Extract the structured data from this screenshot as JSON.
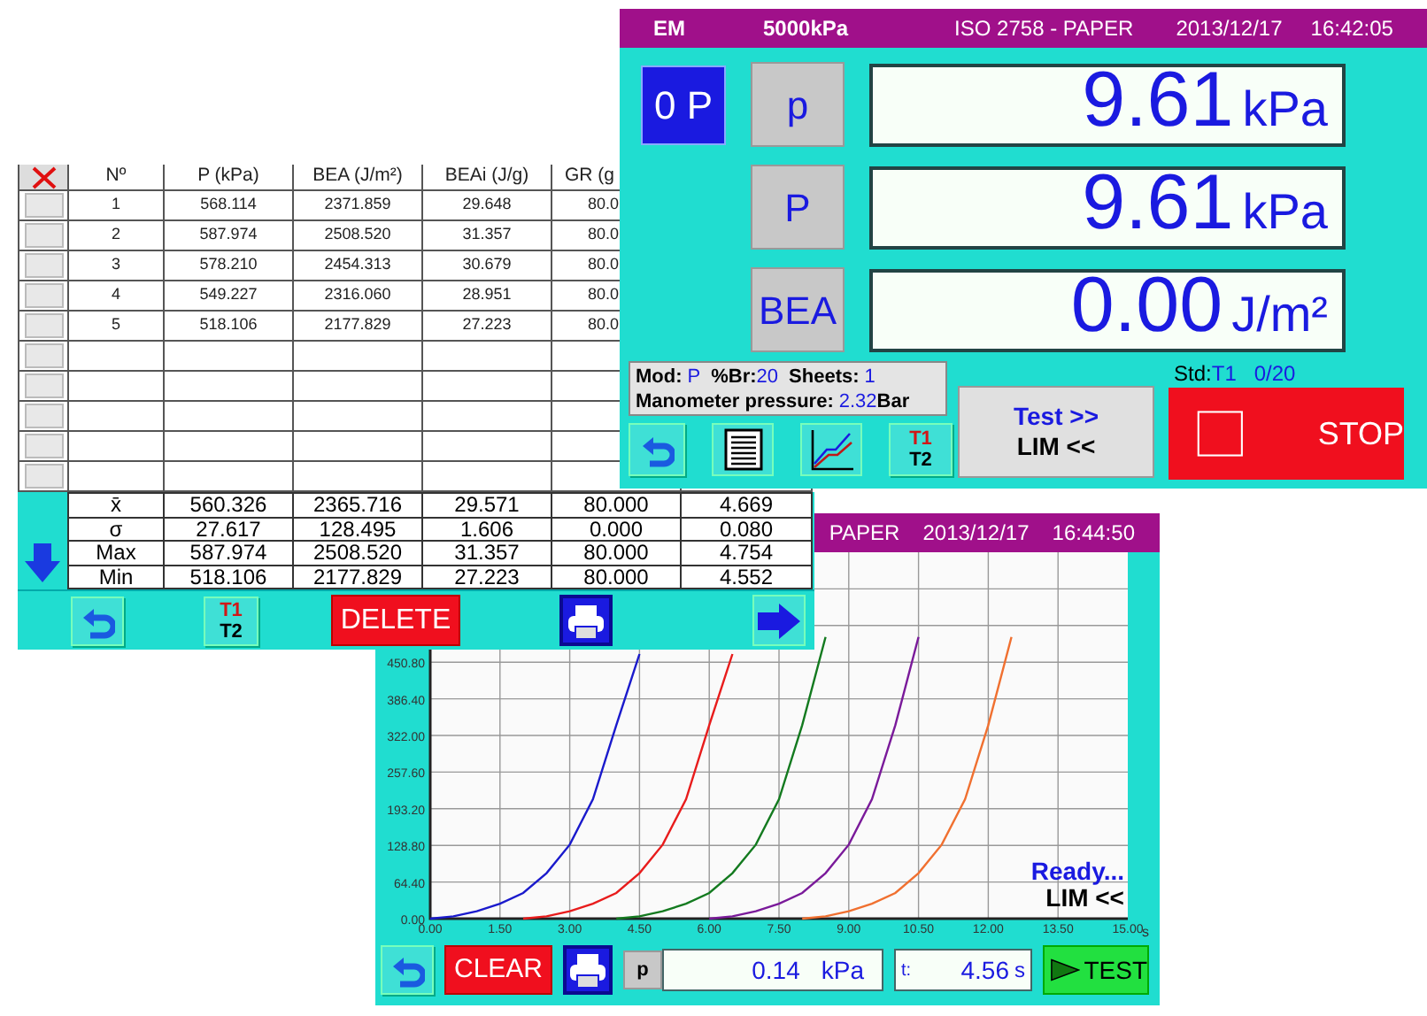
{
  "results_window": {
    "columns": [
      "Nº",
      "P (kPa)",
      "BEA (J/m²)",
      "BEAi (J/g)",
      "GR (g"
    ],
    "rows": [
      {
        "checked": false,
        "cells": [
          "1",
          "568.114",
          "2371.859",
          "29.648",
          "80.0"
        ]
      },
      {
        "checked": false,
        "cells": [
          "2",
          "587.974",
          "2508.520",
          "31.357",
          "80.0"
        ]
      },
      {
        "checked": false,
        "cells": [
          "3",
          "578.210",
          "2454.313",
          "30.679",
          "80.0"
        ]
      },
      {
        "checked": false,
        "cells": [
          "4",
          "549.227",
          "2316.060",
          "28.951",
          "80.0"
        ]
      },
      {
        "checked": false,
        "cells": [
          "5",
          "518.106",
          "2177.829",
          "27.223",
          "80.0"
        ]
      },
      {
        "checked": false
      },
      {
        "checked": false
      },
      {
        "checked": false
      },
      {
        "checked": false
      },
      {
        "checked": false
      }
    ],
    "stats": [
      {
        "label": "x̄",
        "cells": [
          "560.326",
          "2365.716",
          "29.571",
          "80.000",
          "4.669"
        ]
      },
      {
        "label": "σ",
        "cells": [
          "27.617",
          "128.495",
          "1.606",
          "0.000",
          "0.080"
        ]
      },
      {
        "label": "Max",
        "cells": [
          "587.974",
          "2508.520",
          "31.357",
          "80.000",
          "4.754"
        ]
      },
      {
        "label": "Min",
        "cells": [
          "518.106",
          "2177.829",
          "27.223",
          "80.000",
          "4.552"
        ]
      }
    ],
    "toolbar": {
      "t1": "T1",
      "t2": "T2",
      "delete": "DELETE"
    }
  },
  "test_window": {
    "title_bar": [
      "EM",
      "5000kPa",
      "ISO 2758 - PAPER",
      "2013/12/17",
      "16:42:05"
    ],
    "zero_button": "0 P",
    "displays": [
      {
        "key": "p",
        "value": "9.61",
        "unit": "kPa"
      },
      {
        "key": "P",
        "value": "9.61",
        "unit": "kPa"
      },
      {
        "key": "BEA",
        "value": "0.00",
        "unit": "J/m²"
      }
    ],
    "info": {
      "mod_label": "Mod:",
      "mod": "P",
      "br_label": "%Br:",
      "br": "20",
      "sheets_label": "Sheets:",
      "sheets": "1",
      "manometer_label": "Manometer pressure:",
      "manometer": "2.32",
      "manometer_unit": "Bar"
    },
    "std_label": "Std:",
    "std": "T1",
    "count": "0/20",
    "toolbar": {
      "t1": "T1",
      "t2": "T2"
    },
    "test_button": [
      "Test >>",
      "LIM <<"
    ],
    "stop": "STOP"
  },
  "graph_window": {
    "title_bar": [
      "PAPER",
      "2013/12/17",
      "16:44:50"
    ],
    "chart_data": {
      "type": "line",
      "grid": true,
      "xlabel": "s",
      "xlim": [
        0,
        15
      ],
      "ylim": [
        0,
        644
      ],
      "xticks": [
        {
          "value": 0,
          "label": "0.00"
        },
        {
          "value": 1.5,
          "label": "1.50"
        },
        {
          "value": 3,
          "label": "3.00"
        },
        {
          "value": 4.5,
          "label": "4.50"
        },
        {
          "value": 6,
          "label": "6.00"
        },
        {
          "value": 7.5,
          "label": "7.50"
        },
        {
          "value": 9,
          "label": "9.00"
        },
        {
          "value": 10.5,
          "label": "10.50"
        },
        {
          "value": 12,
          "label": "12.00"
        },
        {
          "value": 13.5,
          "label": "13.50"
        },
        {
          "value": 15,
          "label": "15.00"
        }
      ],
      "yticks": [
        {
          "value": 0,
          "label": "0.00"
        },
        {
          "value": 64.4,
          "label": "64.40"
        },
        {
          "value": 128.8,
          "label": "128.80"
        },
        {
          "value": 193.2,
          "label": "193.20"
        },
        {
          "value": 257.6,
          "label": "257.60"
        },
        {
          "value": 322,
          "label": "322.00"
        },
        {
          "value": 386.4,
          "label": "386.40"
        },
        {
          "value": 450.8,
          "label": "450.80"
        }
      ],
      "x": [
        0,
        0.5,
        1,
        1.5,
        2,
        2.5,
        3,
        3.5,
        4,
        4.5,
        5,
        5.5,
        6,
        6.5,
        7,
        7.5,
        8,
        8.5,
        9,
        9.5,
        10,
        10.5,
        11,
        11.5,
        12,
        12.5
      ],
      "series": [
        {
          "color": "#1a1acc",
          "values": [
            0,
            4,
            13,
            26,
            45,
            80,
            130,
            210,
            340,
            465,
            null,
            null,
            null,
            null,
            null,
            null,
            null,
            null,
            null,
            null,
            null,
            null,
            null,
            null,
            null,
            null
          ]
        },
        {
          "color": "#e81c1c",
          "values": [
            null,
            null,
            null,
            null,
            0,
            4,
            13,
            26,
            45,
            80,
            130,
            210,
            340,
            465,
            null,
            null,
            null,
            null,
            null,
            null,
            null,
            null,
            null,
            null,
            null,
            null
          ]
        },
        {
          "color": "#137a1f",
          "values": [
            null,
            null,
            null,
            null,
            null,
            null,
            null,
            null,
            0,
            4,
            13,
            26,
            45,
            80,
            130,
            210,
            340,
            495,
            null,
            null,
            null,
            null,
            null,
            null,
            null,
            null
          ]
        },
        {
          "color": "#7a1a9a",
          "values": [
            null,
            null,
            null,
            null,
            null,
            null,
            null,
            null,
            null,
            null,
            null,
            null,
            0,
            4,
            13,
            26,
            45,
            80,
            130,
            210,
            340,
            495,
            null,
            null,
            null,
            null
          ]
        },
        {
          "color": "#f07030",
          "values": [
            null,
            null,
            null,
            null,
            null,
            null,
            null,
            null,
            null,
            null,
            null,
            null,
            null,
            null,
            null,
            null,
            0,
            4,
            13,
            26,
            45,
            80,
            130,
            210,
            340,
            495
          ]
        }
      ]
    },
    "status": "Ready...",
    "lim": "LIM <<",
    "clear": "CLEAR",
    "p_label": "p",
    "pressure": "0.14",
    "pressure_unit": "kPa",
    "t_label": "t:",
    "time": "4.56",
    "time_unit": "s",
    "test": "TEST"
  }
}
